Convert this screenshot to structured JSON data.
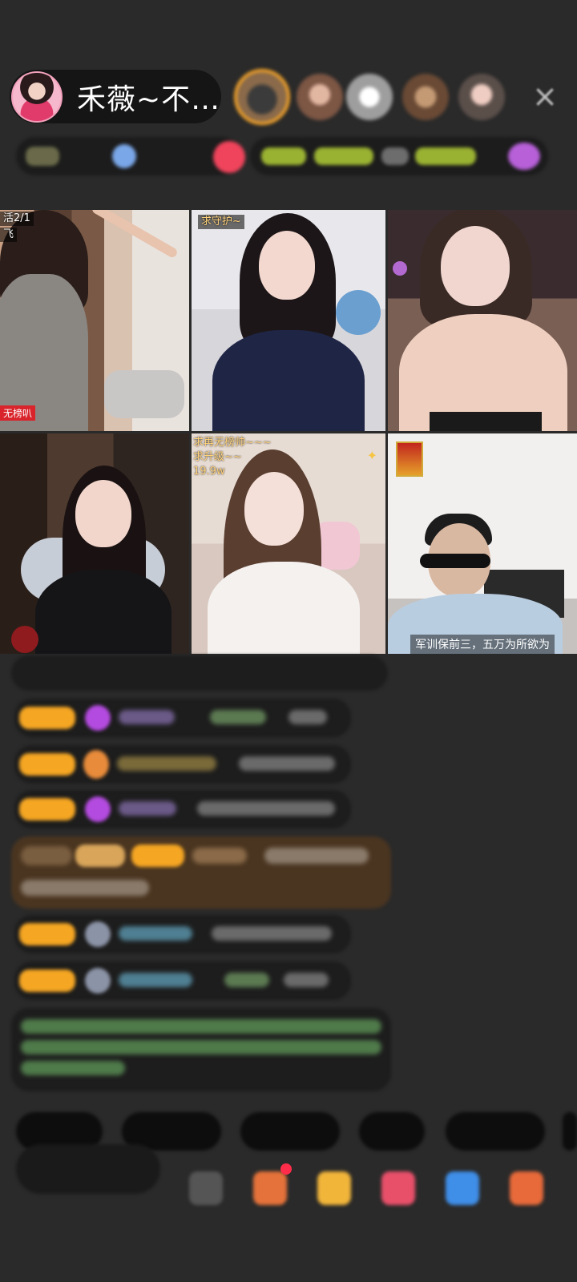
{
  "header": {
    "host_name": "禾薇~不…",
    "close_icon": "×"
  },
  "grid": {
    "cell1_label_top": "活2/1",
    "cell1_label_sub": "飞",
    "cell1_bottom_tag": "无榜叭",
    "cell2_label": "求守护~",
    "cell5_label_l1": "求再无榜帅~~~",
    "cell5_label_l2": "求升级~~",
    "cell5_label_l3": "19.9w",
    "cell6_caption": "军训保前三，五万为所欲为"
  },
  "colors": {
    "background": "#2a2a2a",
    "gold_badge": "#f5a623",
    "host_pill": "#151515"
  }
}
